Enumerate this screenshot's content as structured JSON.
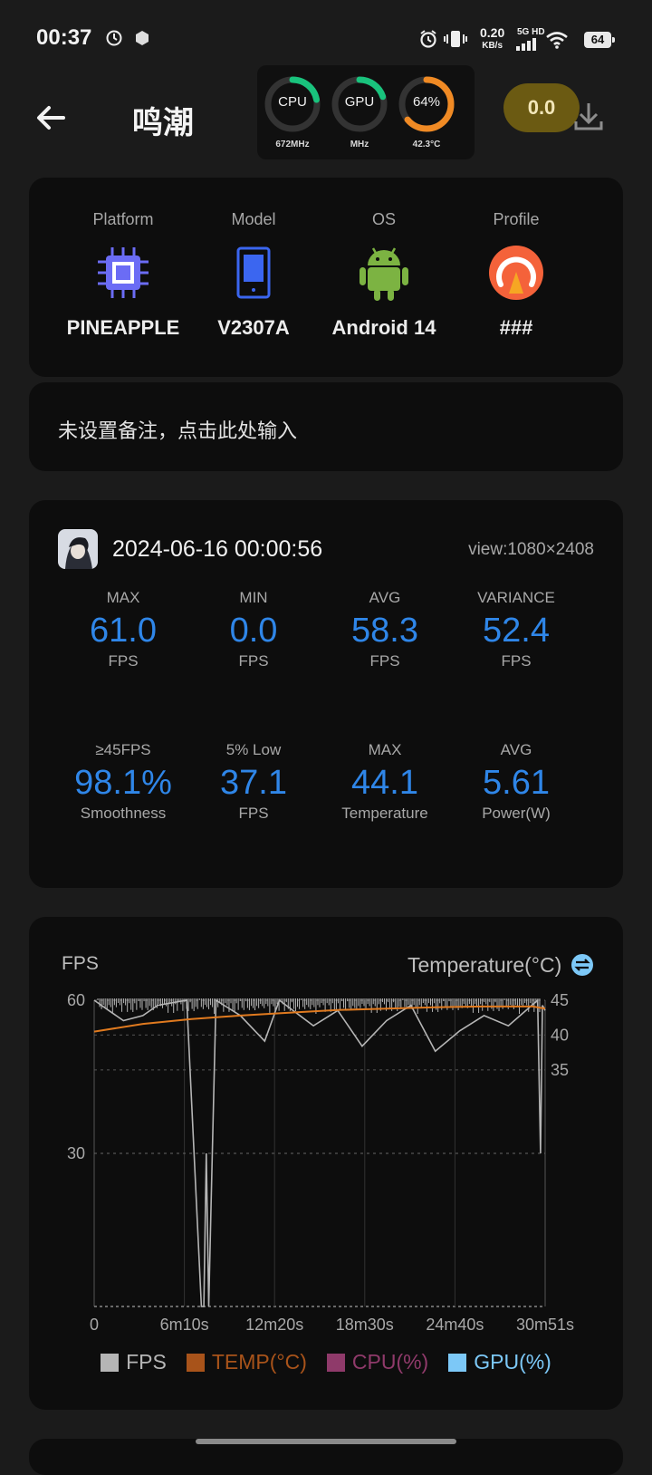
{
  "status_bar": {
    "time": "00:37",
    "net_speed_value": "0.20",
    "net_speed_unit": "KB/s",
    "network_type": "5G HD",
    "battery": "64",
    "icons": [
      "clock-icon",
      "hexagon-notification-icon",
      "alarm-icon",
      "vibrate-icon",
      "signal-icon",
      "wifi-icon",
      "battery-icon"
    ]
  },
  "header": {
    "title": "鸣潮",
    "score": "0.0",
    "back_icon": "back-arrow-icon",
    "download_icon": "download-icon"
  },
  "monitor": {
    "cpu": {
      "label": "CPU",
      "sub": "672MHz",
      "level": 0.22,
      "color": "#19c37d"
    },
    "gpu": {
      "label": "GPU",
      "sub": "MHz",
      "level": 0.2,
      "color": "#19c37d"
    },
    "battery": {
      "label": "64%",
      "sub": "42.3°C",
      "level": 0.64,
      "color": "#f08a24"
    }
  },
  "device": {
    "platform": {
      "label": "Platform",
      "value": "PINEAPPLE",
      "icon": "chip-icon"
    },
    "model": {
      "label": "Model",
      "value": "V2307A",
      "icon": "phone-icon"
    },
    "os": {
      "label": "OS",
      "value": "Android 14",
      "icon": "android-icon"
    },
    "profile": {
      "label": "Profile",
      "value": "###",
      "icon": "profile-gauge-icon"
    }
  },
  "note": {
    "placeholder": "未设置备注，点击此处输入"
  },
  "session": {
    "datetime": "2024-06-16 00:00:56",
    "view": "view:1080×2408",
    "stats_row1": [
      {
        "label": "MAX",
        "value": "61.0",
        "unit": "FPS"
      },
      {
        "label": "MIN",
        "value": "0.0",
        "unit": "FPS"
      },
      {
        "label": "AVG",
        "value": "58.3",
        "unit": "FPS"
      },
      {
        "label": "VARIANCE",
        "value": "52.4",
        "unit": "FPS"
      }
    ],
    "stats_row2": [
      {
        "label": "≥45FPS",
        "value": "98.1%",
        "unit": "Smoothness"
      },
      {
        "label": "5% Low",
        "value": "37.1",
        "unit": "FPS"
      },
      {
        "label": "MAX",
        "value": "44.1",
        "unit": "Temperature"
      },
      {
        "label": "AVG",
        "value": "5.61",
        "unit": "Power(W)"
      }
    ]
  },
  "chart_data": {
    "type": "line",
    "left_axis_title": "FPS",
    "right_axis_title": "Temperature(°C)",
    "x_ticks": [
      "0",
      "6m10s",
      "12m20s",
      "18m30s",
      "24m40s",
      "30m51s"
    ],
    "x_range_seconds": [
      0,
      1851
    ],
    "y_left_ticks": [
      60,
      30
    ],
    "y_left_range": [
      0,
      60
    ],
    "y_right_ticks": [
      45,
      40,
      35
    ],
    "y_right_range": [
      1,
      45
    ],
    "grid": true,
    "series": [
      {
        "name": "FPS",
        "color": "#b5b5b5",
        "baseline": 60,
        "points": [
          [
            0,
            60
          ],
          [
            60,
            58
          ],
          [
            120,
            56
          ],
          [
            200,
            57
          ],
          [
            260,
            59
          ],
          [
            380,
            60
          ],
          [
            440,
            0
          ],
          [
            450,
            0
          ],
          [
            460,
            30
          ],
          [
            470,
            0
          ],
          [
            480,
            20
          ],
          [
            500,
            60
          ],
          [
            600,
            57
          ],
          [
            700,
            52
          ],
          [
            760,
            60
          ],
          [
            900,
            55
          ],
          [
            1000,
            58
          ],
          [
            1100,
            51
          ],
          [
            1200,
            56
          ],
          [
            1300,
            59
          ],
          [
            1400,
            50
          ],
          [
            1500,
            54
          ],
          [
            1600,
            57
          ],
          [
            1700,
            55
          ],
          [
            1820,
            60
          ],
          [
            1832,
            30
          ],
          [
            1840,
            59
          ],
          [
            1851,
            58
          ]
        ]
      },
      {
        "name": "TEMP(°C)",
        "color": "#e07a1f",
        "points": [
          [
            0,
            40.5
          ],
          [
            200,
            41.6
          ],
          [
            400,
            42.3
          ],
          [
            600,
            42.8
          ],
          [
            800,
            43.2
          ],
          [
            1000,
            43.6
          ],
          [
            1200,
            43.8
          ],
          [
            1400,
            44.0
          ],
          [
            1600,
            44.1
          ],
          [
            1800,
            44.1
          ],
          [
            1851,
            43.8
          ]
        ]
      }
    ],
    "legend": [
      {
        "name": "FPS",
        "color": "#b5b5b5"
      },
      {
        "name": "TEMP(°C)",
        "color": "#a8531a"
      },
      {
        "name": "CPU(%)",
        "color": "#8f3a6a"
      },
      {
        "name": "GPU(%)",
        "color": "#7cc8f7"
      }
    ]
  }
}
